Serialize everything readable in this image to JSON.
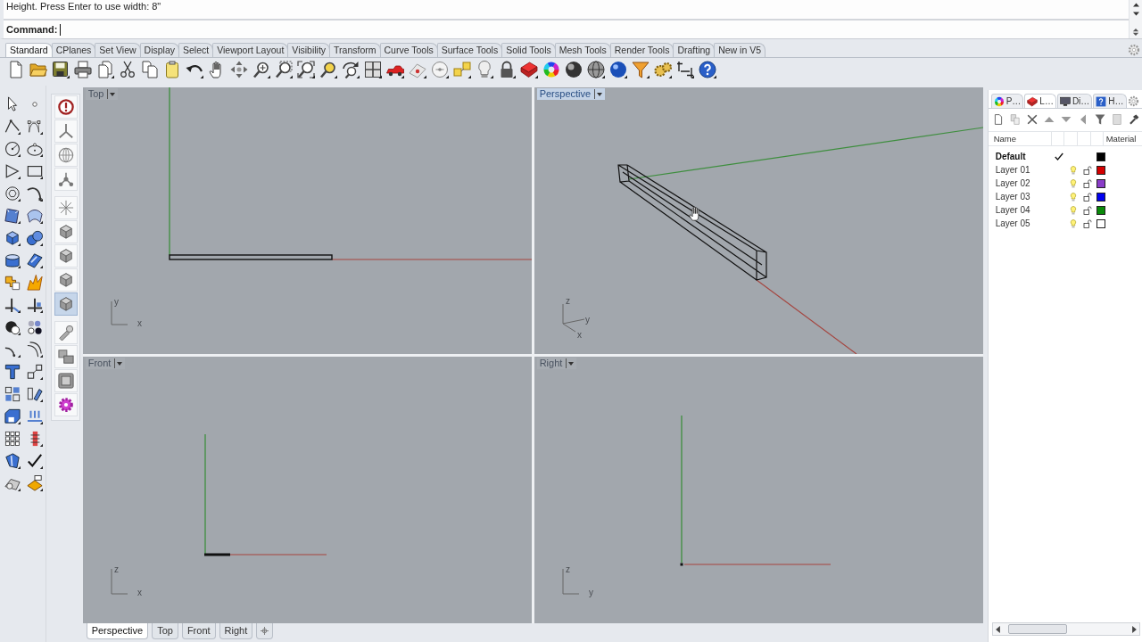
{
  "command_history": {
    "lines": [
      "Height. Press Enter to use width: 8\""
    ]
  },
  "command_line": {
    "label": "Command:"
  },
  "toolbar_tabs": [
    {
      "label": "Standard",
      "selected": true
    },
    {
      "label": "CPlanes",
      "selected": false
    },
    {
      "label": "Set View",
      "selected": false
    },
    {
      "label": "Display",
      "selected": false
    },
    {
      "label": "Select",
      "selected": false
    },
    {
      "label": "Viewport Layout",
      "selected": false
    },
    {
      "label": "Visibility",
      "selected": false
    },
    {
      "label": "Transform",
      "selected": false
    },
    {
      "label": "Curve Tools",
      "selected": false
    },
    {
      "label": "Surface Tools",
      "selected": false
    },
    {
      "label": "Solid Tools",
      "selected": false
    },
    {
      "label": "Mesh Tools",
      "selected": false
    },
    {
      "label": "Render Tools",
      "selected": false
    },
    {
      "label": "Drafting",
      "selected": false
    },
    {
      "label": "New in V5",
      "selected": false
    }
  ],
  "view_toolbar": [
    {
      "selected": false
    },
    {
      "selected": false
    },
    {
      "selected": false
    },
    {
      "selected": false
    },
    {
      "selected": false
    },
    {
      "selected": false
    },
    {
      "selected": false
    },
    {
      "selected": false
    },
    {
      "selected": true
    },
    {
      "selected": false
    },
    {
      "selected": false
    },
    {
      "selected": false
    },
    {
      "selected": false
    }
  ],
  "viewports": [
    {
      "kind": "top",
      "title": "Top",
      "active": false,
      "axis_labels": [
        "y",
        "x"
      ]
    },
    {
      "kind": "perspective",
      "title": "Perspective",
      "active": true,
      "axis_labels": [
        "z",
        "y",
        "x"
      ]
    },
    {
      "kind": "front",
      "title": "Front",
      "active": false,
      "axis_labels": [
        "z",
        "x"
      ]
    },
    {
      "kind": "right",
      "title": "Right",
      "active": false,
      "axis_labels": [
        "z",
        "y"
      ]
    }
  ],
  "viewport_tabs": [
    {
      "label": "Perspective",
      "selected": true
    },
    {
      "label": "Top",
      "selected": false
    },
    {
      "label": "Front",
      "selected": false
    },
    {
      "label": "Right",
      "selected": false
    }
  ],
  "panel": {
    "tabs": [
      {
        "label": "P…",
        "selected": false
      },
      {
        "label": "L…",
        "selected": true
      },
      {
        "label": "Di…",
        "selected": false
      },
      {
        "label": "H…",
        "selected": false
      }
    ],
    "columns": [
      "Name",
      "Material"
    ],
    "layers": [
      {
        "name": "Default",
        "current": true,
        "color": "#000000"
      },
      {
        "name": "Layer 01",
        "current": false,
        "color": "#d40000"
      },
      {
        "name": "Layer 02",
        "current": false,
        "color": "#8a3cc8"
      },
      {
        "name": "Layer 03",
        "current": false,
        "color": "#0000f0"
      },
      {
        "name": "Layer 04",
        "current": false,
        "color": "#0a8a0a"
      },
      {
        "name": "Layer 05",
        "current": false,
        "color": "#ffffff"
      }
    ]
  }
}
